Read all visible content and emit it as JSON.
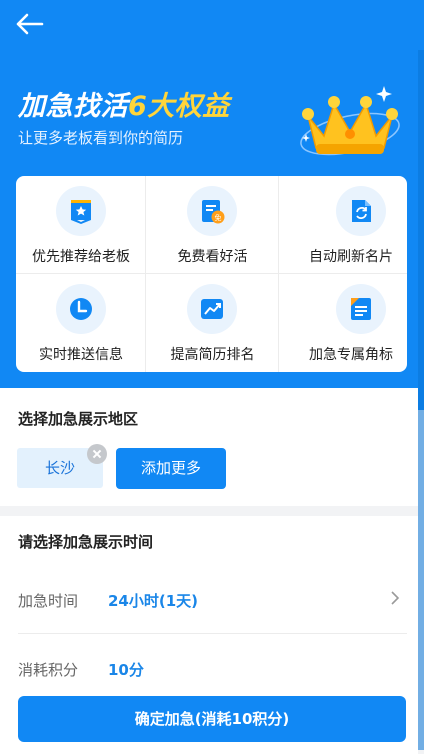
{
  "hero": {
    "title_main": "加急找活",
    "title_accent": "6大权益",
    "subtitle": "让更多老板看到你的简历"
  },
  "benefits": [
    {
      "label": "优先推荐给老板",
      "icon": "star-bookmark-icon"
    },
    {
      "label": "免费看好活",
      "icon": "free-document-icon"
    },
    {
      "label": "自动刷新名片",
      "icon": "refresh-document-icon"
    },
    {
      "label": "实时推送信息",
      "icon": "clock-icon"
    },
    {
      "label": "提高简历排名",
      "icon": "trend-chart-icon"
    },
    {
      "label": "加急专属角标",
      "icon": "badge-document-icon"
    }
  ],
  "region": {
    "title": "选择加急展示地区",
    "selected_city": "长沙",
    "add_more_label": "添加更多"
  },
  "time": {
    "title": "请选择加急展示时间",
    "duration_label": "加急时间",
    "duration_value": "24小时(1天)",
    "cost_label": "消耗积分",
    "cost_value": "10分"
  },
  "confirm_label": "确定加急(消耗10积分)",
  "colors": {
    "primary": "#1188f4",
    "accent_gold": "#ffd53b",
    "value_blue": "#1a86e8",
    "chip_bg": "#e3f1fd"
  }
}
